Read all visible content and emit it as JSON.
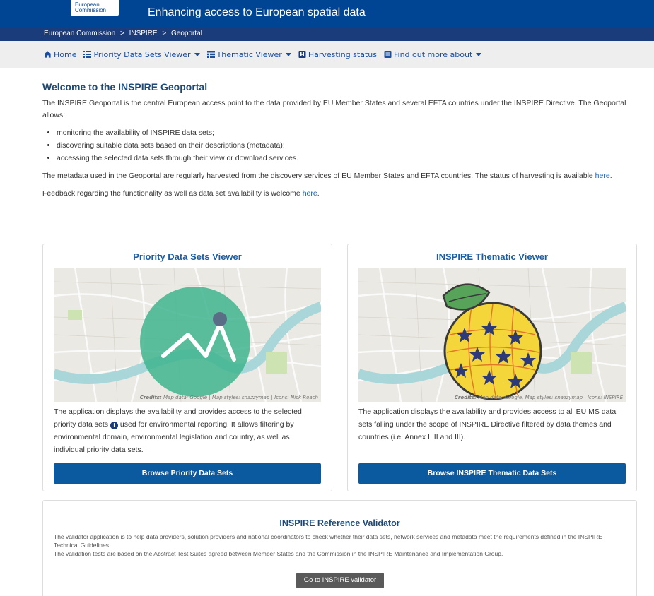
{
  "header": {
    "logo_line1": "European",
    "logo_line2": "Commission",
    "title": "Enhancing access to European spatial data"
  },
  "breadcrumb": {
    "items": [
      "European Commission",
      ">",
      "INSPIRE",
      ">",
      "Geoportal"
    ]
  },
  "nav": {
    "home": "Home",
    "priority": "Priority Data Sets Viewer",
    "thematic": "Thematic Viewer",
    "harvesting": "Harvesting status",
    "findout": "Find out more about"
  },
  "intro": {
    "heading": "Welcome to the INSPIRE Geoportal",
    "p1": "The INSPIRE Geoportal is the central European access point to the data provided by EU Member States and several EFTA countries under the INSPIRE Directive. The Geoportal allows:",
    "bullets": [
      "monitoring the availability of INSPIRE data sets;",
      "discovering suitable data sets based on their descriptions (metadata);",
      "accessing the selected data sets through their view or download services."
    ],
    "p2": "The metadata used in the Geoportal are regularly harvested from the discovery services of EU Member States and EFTA countries. The status of harvesting is available",
    "p2_link": "here",
    "p3": "Feedback regarding the functionality as well as data set availability is welcome",
    "p3_link": "here"
  },
  "card_priority": {
    "title": "Priority Data Sets Viewer",
    "credits_label": "Credits:",
    "credits": "Map data: Google | Map styles: snazzymap | Icons: Nick Roach",
    "text_a": "The application displays the availability and provides access to the selected priority data sets",
    "info_glyph": "i",
    "text_b": "used for environmental reporting. It allows filtering by environmental domain, environmental legislation and country, as well as individual priority data sets.",
    "button": "Browse Priority Data Sets"
  },
  "card_thematic": {
    "title": "INSPIRE Thematic Viewer",
    "credits_label": "Credits:",
    "credits": "Map data: Google, Map styles: snazzymap | Icons: INSPIRE",
    "text": "The application displays the availability and provides access to all EU MS data sets falling under the scope of INSPIRE Directive filtered by data themes and countries (i.e. Annex I, II and III).",
    "button": "Browse INSPIRE Thematic Data Sets"
  },
  "validator": {
    "title": "INSPIRE Reference Validator",
    "p1": "The validator application is to help data providers, solution providers and national coordinators to check whether their data sets, network services and metadata meet the requirements defined in the INSPIRE Technical Guidelines.",
    "p2": "The validation tests are based on the Abstract Test Suites agreed between Member States and the Commission in the INSPIRE Maintenance and Implementation Group.",
    "button": "Go to INSPIRE validator"
  },
  "colors": {
    "topbar": "#004494",
    "crumbbar": "#1a3c7a",
    "primary_button": "#0b5aa0",
    "link": "#1565c0",
    "pds_circle": "#3fb58f",
    "thematic_yellow": "#f5d63a",
    "thematic_star": "#2c3a7a",
    "leaf": "#58a35a"
  },
  "icons": [
    "home-icon",
    "list-icon",
    "grid-icon",
    "harvest-icon",
    "book-icon",
    "info-icon",
    "chevron-down-icon"
  ]
}
